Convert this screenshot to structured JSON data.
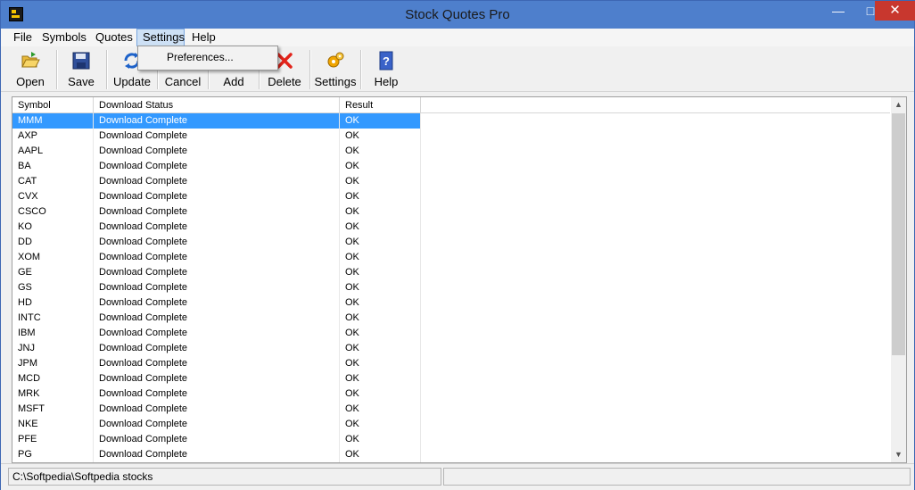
{
  "window": {
    "title": "Stock Quotes Pro"
  },
  "titlebar_buttons": {
    "minimize": "—",
    "maximize": "□",
    "close": "✕"
  },
  "menu": [
    "File",
    "Symbols",
    "Quotes",
    "Settings",
    "Help"
  ],
  "dropdown": {
    "items": [
      "Preferences..."
    ]
  },
  "toolbar": [
    {
      "label": "Open",
      "icon": "folder-open-icon"
    },
    {
      "label": "Save",
      "icon": "floppy-save-icon"
    },
    {
      "label": "Update",
      "icon": "refresh-icon"
    },
    {
      "label": "Cancel",
      "icon": "cancel-icon"
    },
    {
      "label": "Add",
      "icon": "add-icon"
    },
    {
      "label": "Delete",
      "icon": "delete-x-icon"
    },
    {
      "label": "Settings",
      "icon": "gears-icon"
    },
    {
      "label": "Help",
      "icon": "help-book-icon"
    }
  ],
  "table": {
    "columns": [
      "Symbol",
      "Download Status",
      "Result"
    ],
    "selected_row": 0,
    "rows": [
      [
        "MMM",
        "Download Complete",
        "OK"
      ],
      [
        "AXP",
        "Download Complete",
        "OK"
      ],
      [
        "AAPL",
        "Download Complete",
        "OK"
      ],
      [
        "BA",
        "Download Complete",
        "OK"
      ],
      [
        "CAT",
        "Download Complete",
        "OK"
      ],
      [
        "CVX",
        "Download Complete",
        "OK"
      ],
      [
        "CSCO",
        "Download Complete",
        "OK"
      ],
      [
        "KO",
        "Download Complete",
        "OK"
      ],
      [
        "DD",
        "Download Complete",
        "OK"
      ],
      [
        "XOM",
        "Download Complete",
        "OK"
      ],
      [
        "GE",
        "Download Complete",
        "OK"
      ],
      [
        "GS",
        "Download Complete",
        "OK"
      ],
      [
        "HD",
        "Download Complete",
        "OK"
      ],
      [
        "INTC",
        "Download Complete",
        "OK"
      ],
      [
        "IBM",
        "Download Complete",
        "OK"
      ],
      [
        "JNJ",
        "Download Complete",
        "OK"
      ],
      [
        "JPM",
        "Download Complete",
        "OK"
      ],
      [
        "MCD",
        "Download Complete",
        "OK"
      ],
      [
        "MRK",
        "Download Complete",
        "OK"
      ],
      [
        "MSFT",
        "Download Complete",
        "OK"
      ],
      [
        "NKE",
        "Download Complete",
        "OK"
      ],
      [
        "PFE",
        "Download Complete",
        "OK"
      ],
      [
        "PG",
        "Download Complete",
        "OK"
      ]
    ]
  },
  "status": {
    "path": "C:\\Softpedia\\Softpedia stocks",
    "right": ""
  },
  "colors": {
    "selection": "#3399ff",
    "titlebar": "#4e7fcc",
    "close": "#c8372e"
  }
}
